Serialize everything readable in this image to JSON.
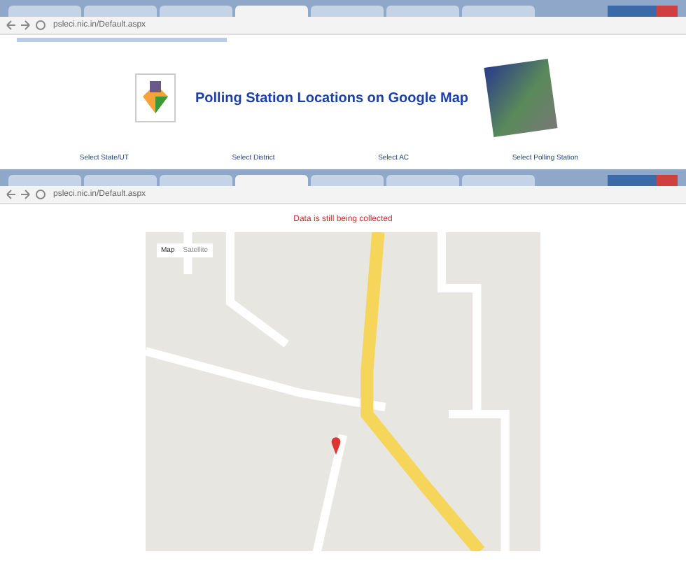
{
  "back_window": {
    "tabs": [
      {
        "selected": false
      },
      {
        "selected": false
      },
      {
        "selected": false
      },
      {
        "selected": true
      },
      {
        "selected": false
      },
      {
        "selected": false
      },
      {
        "selected": false
      }
    ],
    "address": "psleci.nic.in/Default.aspx",
    "header": {
      "title": "Polling Station Locations on Google Map"
    },
    "selects": [
      "Select State/UT",
      "Select District",
      "Select AC",
      "Select Polling Station"
    ]
  },
  "front_window": {
    "tabs": [
      {
        "selected": false
      },
      {
        "selected": false
      },
      {
        "selected": false
      },
      {
        "selected": true
      },
      {
        "selected": false
      },
      {
        "selected": false
      },
      {
        "selected": false
      }
    ],
    "address": "psleci.nic.in/Default.aspx",
    "message": "Data is still being collected",
    "map": {
      "map_types": [
        {
          "label": "Map",
          "selected": true
        },
        {
          "label": "Satellite",
          "selected": false
        }
      ]
    }
  }
}
